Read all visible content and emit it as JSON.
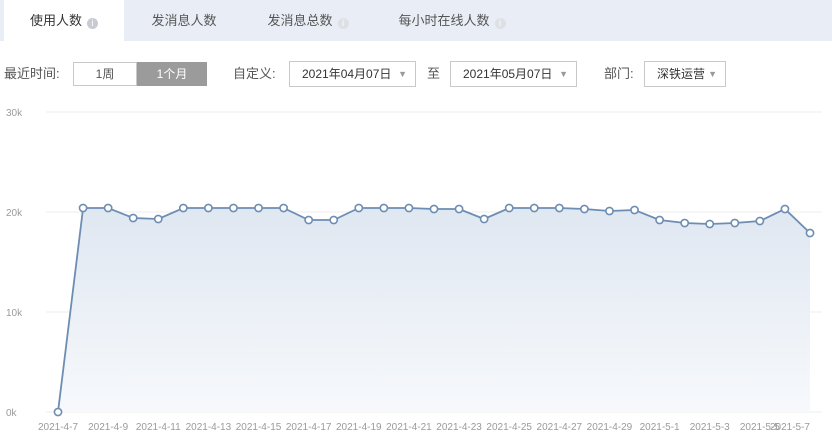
{
  "tabs": [
    {
      "label": "使用人数",
      "icon": "info-icon"
    },
    {
      "label": "发消息人数"
    },
    {
      "label": "发消息总数",
      "icon": "info-icon"
    },
    {
      "label": "每小时在线人数",
      "icon": "info-icon"
    }
  ],
  "filters": {
    "recent_label": "最近时间:",
    "week_label": "1周",
    "month_label": "1个月",
    "custom_label": "自定义:",
    "start_date": "2021年04月07日",
    "to_label": "至",
    "end_date": "2021年05月07日",
    "dept_label": "部门:",
    "dept_value": "深铁运营"
  },
  "chart_data": {
    "type": "area",
    "x": [
      "2021-4-7",
      "2021-4-8",
      "2021-4-9",
      "2021-4-10",
      "2021-4-11",
      "2021-4-12",
      "2021-4-13",
      "2021-4-14",
      "2021-4-15",
      "2021-4-16",
      "2021-4-17",
      "2021-4-18",
      "2021-4-19",
      "2021-4-20",
      "2021-4-21",
      "2021-4-22",
      "2021-4-23",
      "2021-4-24",
      "2021-4-25",
      "2021-4-26",
      "2021-4-27",
      "2021-4-28",
      "2021-4-29",
      "2021-4-30",
      "2021-5-1",
      "2021-5-2",
      "2021-5-3",
      "2021-5-4",
      "2021-5-5",
      "2021-5-6",
      "2021-5-7"
    ],
    "x_tick_labels": [
      "2021-4-7",
      "2021-4-9",
      "2021-4-11",
      "2021-4-13",
      "2021-4-15",
      "2021-4-17",
      "2021-4-19",
      "2021-4-21",
      "2021-4-23",
      "2021-4-25",
      "2021-4-27",
      "2021-4-29",
      "2021-5-1",
      "2021-5-3",
      "2021-5-5",
      "2021-5-7"
    ],
    "series": [
      {
        "values": [
          0,
          20400,
          20400,
          19400,
          19300,
          20400,
          20400,
          20400,
          20400,
          20400,
          19200,
          19200,
          20400,
          20400,
          20400,
          20300,
          20300,
          19300,
          20400,
          20400,
          20400,
          20300,
          20100,
          20200,
          19200,
          18900,
          18800,
          18900,
          19100,
          20300,
          17900
        ]
      }
    ],
    "ylim": [
      0,
      30000
    ],
    "y_ticks": [
      0,
      10000,
      20000,
      30000
    ],
    "y_tick_labels": [
      "0k",
      "10k",
      "20k",
      "30k"
    ],
    "grid": true,
    "colors": {
      "line": "#6d8db3",
      "fill_top": "#dfe7f1",
      "fill_bottom": "#f7f9fc",
      "grid": "#eeeeee",
      "tick_text": "#9a9a9a"
    }
  }
}
